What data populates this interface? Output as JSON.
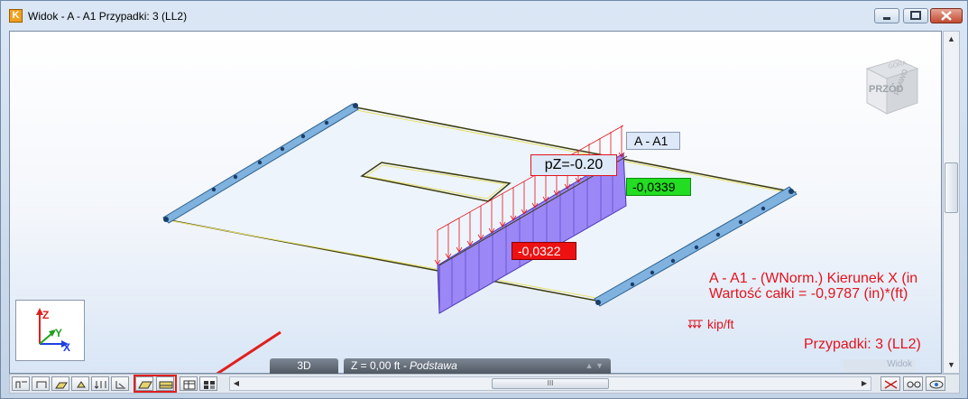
{
  "window": {
    "title": "Widok -  A - A1 Przypadki: 3 (LL2)",
    "app_icon": "K"
  },
  "viewport": {
    "section_label": "A - A1",
    "pz_label": "pZ=-0.20",
    "value_max_label": "-0,0339",
    "value_min_label": "-0,0322",
    "result_title": "A - A1 - (WNorm.) Kierunek X (in",
    "result_integral": "Wartość całki = -0,9787 (in)*(ft)",
    "unit_label": "kip/ft",
    "cases_label": "Przypadki: 3 (LL2)",
    "navcube": {
      "front_label": "PRZÓD",
      "top_label": "GÓRA",
      "right_label": "PRAWO"
    },
    "axes": {
      "x": "X",
      "y": "Y",
      "z": "Z"
    },
    "colors": {
      "result_text": "#e2141e",
      "max_value_bg": "#22dd22",
      "min_value_bg": "#ee1111",
      "diagram_fill": "#9b87f5",
      "load_arrows": "#e2141e",
      "beam": "#7fb2de"
    }
  },
  "statusbar": {
    "view_mode_button": "3D",
    "level_label": "Z = 0,00 ft",
    "level_name": "- Podstawa",
    "window_label": "Widok",
    "hscroll_thumb_glyph": "III"
  },
  "icons": {
    "title": [
      "minimize-icon",
      "maximize-icon",
      "close-icon"
    ],
    "toolbar": [
      "node-numbers-icon",
      "bar-numbers-icon",
      "panel-numbers-icon",
      "supports-icon",
      "loads-icon",
      "section-icon",
      "panel-display-icon",
      "panel-cut-icon",
      "table-icon",
      "grid-icon"
    ]
  }
}
